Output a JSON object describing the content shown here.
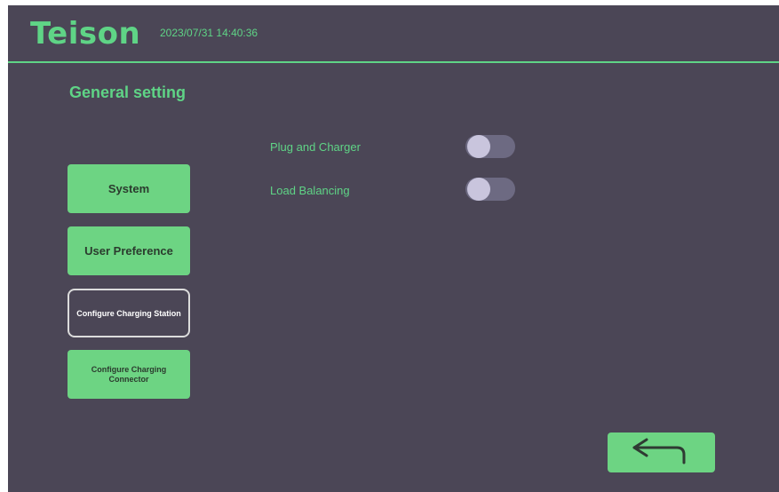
{
  "header": {
    "logo_text": "Teison",
    "datetime": "2023/07/31 14:40:36"
  },
  "page": {
    "title": "General setting"
  },
  "menu": {
    "system": "System",
    "user_preference": "User Preference",
    "configure_charging_station": "Configure Charging Station",
    "configure_charging_connector": "Configure Charging Connector",
    "active": "configure_charging_station"
  },
  "settings": [
    {
      "label": "Plug and Charger",
      "enabled": false
    },
    {
      "label": "Load Balancing",
      "enabled": false
    }
  ],
  "footer": {
    "back_icon": "return-arrow-icon"
  },
  "colors": {
    "background": "#4b4656",
    "accent": "#5fd486",
    "button": "#6dd483",
    "toggle_track": "#6d6a82",
    "toggle_knob": "#c9c5dd"
  }
}
